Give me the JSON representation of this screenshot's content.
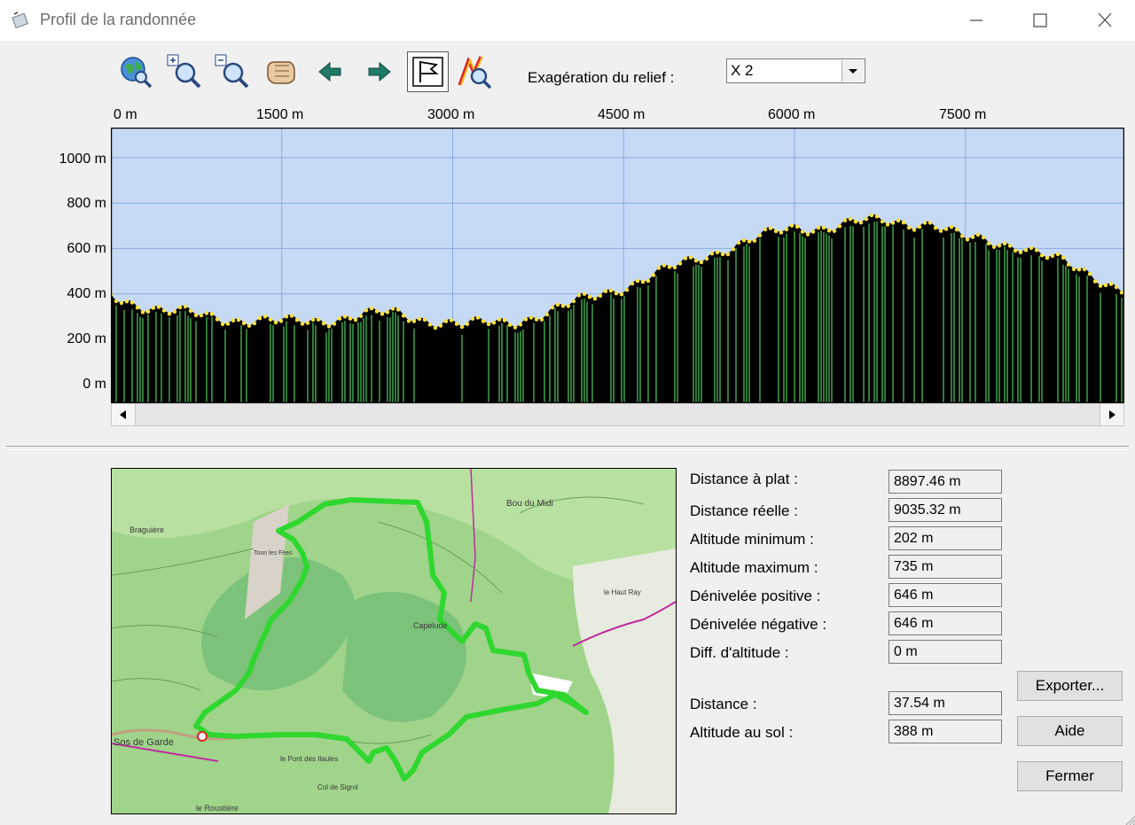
{
  "window": {
    "title": "Profil de la randonnée",
    "controls": [
      "minimize-icon",
      "maximize-icon",
      "close-icon"
    ]
  },
  "toolbar": {
    "buttons": [
      "globe-search-icon",
      "zoom-in-icon",
      "zoom-out-icon",
      "pan-hand-icon",
      "arrow-left-icon",
      "arrow-right-icon",
      "flag-icon",
      "route-zoom-icon"
    ],
    "exaggeration_label": "Exagération du relief :",
    "exaggeration_value": "X 2"
  },
  "profile": {
    "x_ticks": [
      "0 m",
      "1500 m",
      "3000 m",
      "4500 m",
      "6000 m",
      "7500 m"
    ],
    "y_ticks": [
      "1000 m",
      "800 m",
      "600 m",
      "400 m",
      "200 m",
      "0 m"
    ],
    "colors": {
      "sky": "#c6d9f5",
      "terrain": "#000000",
      "grid": "#8aaae6",
      "vegetation": "#3fa34d",
      "points": "#ffe23a"
    },
    "profile_km": [
      0,
      0.5,
      1.0,
      1.5,
      2.0,
      2.5,
      3.0,
      3.1,
      3.5,
      4.0,
      4.5,
      5.0,
      5.4,
      6.0,
      6.5,
      7.0,
      7.2,
      7.5,
      8.0,
      8.5,
      8.9
    ],
    "profile_alt": [
      400,
      320,
      300,
      272,
      300,
      315,
      275,
      260,
      280,
      345,
      440,
      525,
      610,
      690,
      715,
      720,
      720,
      640,
      620,
      500,
      430
    ]
  },
  "stats": [
    {
      "label": "Distance à plat :",
      "value": "8897.46 m"
    },
    {
      "label": "Distance réelle :",
      "value": "9035.32 m"
    },
    {
      "label": "Altitude minimum :",
      "value": "202 m"
    },
    {
      "label": "Altitude maximum :",
      "value": "735 m"
    },
    {
      "label": "Dénivelée positive :",
      "value": "646 m"
    },
    {
      "label": "Dénivelée négative :",
      "value": "646 m"
    },
    {
      "label": "Diff. d'altitude :",
      "value": "0 m"
    }
  ],
  "cursor": [
    {
      "label": "Distance :",
      "value": "37.54 m"
    },
    {
      "label": "Altitude au sol :",
      "value": "388 m"
    }
  ],
  "buttons": {
    "export": "Exporter...",
    "help": "Aide",
    "close": "Fermer"
  },
  "map": {
    "labels": [
      "Braguière",
      "Bou du Midi",
      "Sos de Garde",
      "Capelude",
      "le Pont des Ilaules",
      "Col de Sigrol",
      "le Roustière",
      "le Haut Ray",
      "Tonn les Fées"
    ],
    "route_color": "#2fd72f"
  }
}
